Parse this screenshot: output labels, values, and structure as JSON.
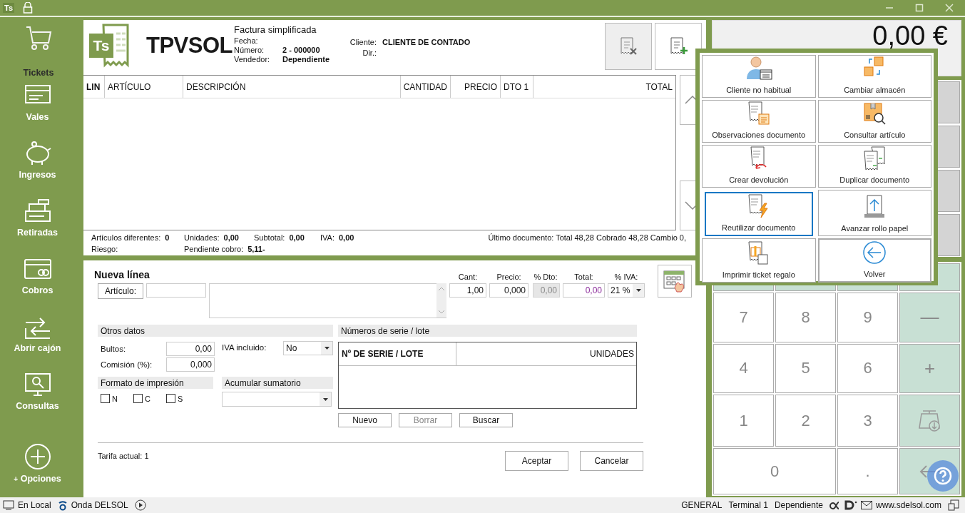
{
  "title_bar": {
    "app_badge": "Ts"
  },
  "sidebar": {
    "items": [
      {
        "label": "Tickets",
        "kind": "cart",
        "selected": true
      },
      {
        "label": "Vales",
        "kind": "voucher",
        "selected": false
      },
      {
        "label": "Ingresos",
        "kind": "piggy",
        "selected": false
      },
      {
        "label": "Retiradas",
        "kind": "register",
        "selected": false
      },
      {
        "label": "Cobros",
        "kind": "card",
        "selected": false
      },
      {
        "label": "Abrir cajón",
        "kind": "drawer",
        "selected": false
      },
      {
        "label": "Consultas",
        "kind": "monitor",
        "selected": false
      }
    ],
    "options": {
      "prefix": "+",
      "label": "Opciones"
    }
  },
  "document": {
    "logo_badge": "Ts",
    "logo_text": "TPVSOL",
    "type": "Factura simplificada",
    "fields": [
      {
        "label": "Fecha:"
      },
      {
        "label": "Número:",
        "value": "2 - 000000"
      },
      {
        "label": "Vendedor:",
        "value": "Dependiente"
      }
    ],
    "client_fields": [
      {
        "label": "Cliente:",
        "value": "CLIENTE DE CONTADO"
      },
      {
        "label": "Dir.:"
      }
    ]
  },
  "lines_table": {
    "columns": [
      "LIN",
      "ARTÍCULO",
      "DESCRIPCIÓN",
      "CANTIDAD",
      "PRECIO",
      "DTO 1",
      "TOTAL"
    ]
  },
  "summary": {
    "row_1": [
      {
        "label": "Artículos diferentes:",
        "value": "0"
      },
      {
        "label": "Unidades:",
        "value": "0,00"
      },
      {
        "label": "Subtotal:",
        "value": "0,00"
      },
      {
        "label": "IVA:",
        "value": "0,00"
      }
    ],
    "row_2": [
      {
        "label": "Riesgo:"
      },
      {
        "label": "Pendiente cobro:",
        "value": "5,11-"
      }
    ],
    "last_document": "Último documento: Total 48,28 Cobrado 48,28 Cambio 0,"
  },
  "new_line": {
    "title": "Nueva línea",
    "article_button": "Artículo:",
    "amounts": [
      {
        "label": "Cant:",
        "value": "1,00",
        "disabled": false,
        "kind": "number"
      },
      {
        "label": "Precio:",
        "value": "0,000",
        "disabled": false,
        "kind": "number"
      },
      {
        "label": "% Dto:",
        "value": "0,00",
        "disabled": true,
        "kind": "number"
      },
      {
        "label": "Total:",
        "value": "0,00",
        "disabled": false,
        "kind": "total"
      },
      {
        "label": "% IVA:",
        "value": "21 %",
        "disabled": false,
        "kind": "select"
      }
    ],
    "other_data": {
      "title": "Otros datos",
      "bultos": {
        "label": "Bultos:",
        "value": "0,00"
      },
      "comision": {
        "label": "Comisión (%):",
        "value": "0,000"
      },
      "iva_incluido": {
        "label": "IVA incluido:",
        "value": "No"
      }
    },
    "print_format": {
      "title": "Formato de impresión",
      "options": [
        {
          "label": "N",
          "checked": false
        },
        {
          "label": "C",
          "checked": false
        },
        {
          "label": "S",
          "checked": false
        }
      ]
    },
    "accumulate": {
      "title": "Acumular sumatorio"
    },
    "serials": {
      "title": "Números de serie / lote",
      "columns": [
        "Nº DE SERIE / LOTE",
        "UNIDADES"
      ],
      "buttons": [
        {
          "label": "Nuevo",
          "disabled": false
        },
        {
          "label": "Borrar",
          "disabled": true
        },
        {
          "label": "Buscar",
          "disabled": false
        }
      ]
    },
    "tariff": "Tarifa actual: 1",
    "buttons": [
      "Aceptar",
      "Cancelar"
    ]
  },
  "total_display": "0,00 €",
  "keypad": {
    "keys": [
      {
        "label": "7",
        "kind": "digit"
      },
      {
        "label": "8",
        "kind": "digit"
      },
      {
        "label": "9",
        "kind": "digit"
      },
      {
        "label": "—",
        "kind": "op"
      },
      {
        "label": "4",
        "kind": "digit"
      },
      {
        "label": "5",
        "kind": "digit"
      },
      {
        "label": "6",
        "kind": "digit"
      },
      {
        "label": "+",
        "kind": "op"
      },
      {
        "label": "1",
        "kind": "digit"
      },
      {
        "label": "2",
        "kind": "digit"
      },
      {
        "label": "3",
        "kind": "digit"
      },
      {
        "kind": "scale"
      },
      {
        "label": "0",
        "kind": "zero"
      },
      {
        "label": ".",
        "kind": "digit"
      },
      {
        "kind": "backspace"
      }
    ]
  },
  "popup": {
    "items": [
      {
        "label": "Cliente no habitual",
        "kind": "client",
        "selected": false
      },
      {
        "label": "Cambiar almacén",
        "kind": "warehouse",
        "selected": false
      },
      {
        "label": "Observaciones documento",
        "kind": "notes",
        "selected": false
      },
      {
        "label": "Consultar artículo",
        "kind": "lookup",
        "selected": false
      },
      {
        "label": "Crear devolución",
        "kind": "refund",
        "selected": false
      },
      {
        "label": "Duplicar documento",
        "kind": "duplicate",
        "selected": false
      },
      {
        "label": "Reutilizar documento",
        "kind": "reuse",
        "selected": true
      },
      {
        "label": "Avanzar rollo papel",
        "kind": "paper",
        "selected": false
      },
      {
        "label": "Imprimir ticket regalo",
        "kind": "gift",
        "selected": false
      },
      {
        "label": "Volver",
        "kind": "back",
        "selected": false
      }
    ]
  },
  "status_bar": {
    "left": [
      {
        "label": "En Local",
        "kind": "monitor"
      },
      {
        "label": "Onda DELSOL",
        "kind": "radio"
      }
    ],
    "right": [
      "GENERAL",
      "Terminal 1",
      "Dependiente"
    ],
    "website": "www.sdelsol.com"
  }
}
